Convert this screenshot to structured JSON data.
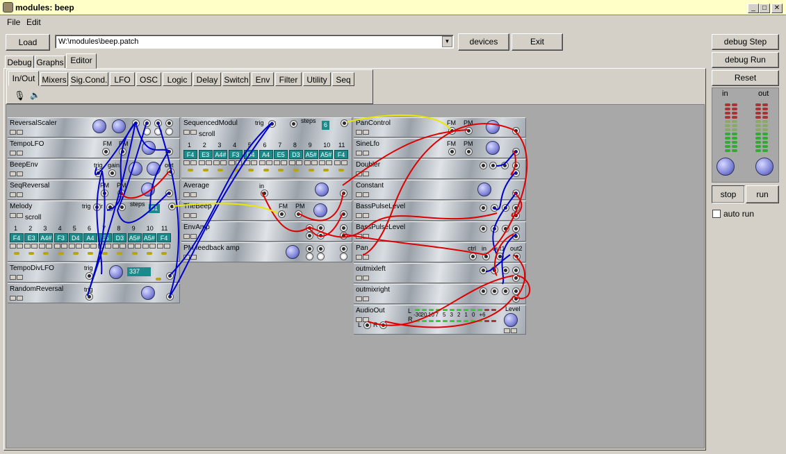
{
  "window": {
    "title": "modules: beep",
    "min": "_",
    "max": "□",
    "close": "✕"
  },
  "menu": {
    "file": "File",
    "edit": "Edit"
  },
  "toolbar": {
    "load": "Load",
    "path": "W:\\modules\\beep.patch",
    "devices": "devices",
    "exit": "Exit"
  },
  "side": {
    "debug_step": "debug Step",
    "debug_run": "debug Run",
    "reset": "Reset",
    "in": "in",
    "out": "out",
    "stop": "stop",
    "run": "run",
    "auto_run": "auto run"
  },
  "tabs": [
    "Debug",
    "Graphs",
    "Editor"
  ],
  "cat_tabs": [
    "In/Out",
    "Mixers",
    "Sig.Cond.",
    "LFO",
    "OSC",
    "Logic",
    "Delay",
    "Switch",
    "Env",
    "Filter",
    "Utility",
    "Seq"
  ],
  "modules": {
    "reversal_scaler": "ReversalScaler",
    "tempo_lfo": "TempoLFO",
    "beep_env": "BeepEnv",
    "seq_reversal": "SeqReversal",
    "melody": "Melody",
    "tempo_div_lfo": "TempoDivLFO",
    "random_reversal": "RandomReversal",
    "sequenced_modul": "SequencedModul",
    "average": "Average",
    "the_beep": "TheBeep",
    "env_amp": "EnvAmp",
    "pm_feedback": "PM feedback amp",
    "pan_control": "PanControl",
    "sine_lfo": "SineLfo",
    "doubler": "Doubler",
    "constant": "Constant",
    "bass_pulse_1": "BassPulseLevel",
    "bass_pulse_2": "BassPulseLevel",
    "pan": "Pan",
    "outmixleft": "outmixleft",
    "outmixright": "outmixright",
    "audio_out": "AudioOut"
  },
  "labels": {
    "fm": "FM",
    "pm": "PM",
    "trig": "trig",
    "gain": "gain",
    "out": "out",
    "dir": "dir",
    "steps": "steps",
    "scroll": "scroll",
    "in": "in",
    "ctrl": "ctrl",
    "out1": "out1",
    "out2": "out2",
    "level": "Level",
    "l": "L",
    "r": "R"
  },
  "values": {
    "melody_steps": "81",
    "seqmod_steps": "6",
    "tempodiv": "337"
  },
  "step_nums": [
    "1",
    "2",
    "3",
    "4",
    "5",
    "6",
    "7",
    "8",
    "9",
    "10",
    "11"
  ],
  "melody_notes": [
    "F4",
    "E3",
    "A4#",
    "F3",
    "D4",
    "A4",
    "E5",
    "D3",
    "A5#",
    "A5#",
    "F4"
  ],
  "seqmod_notes": [
    "F4",
    "E3",
    "A4#",
    "F3",
    "D4",
    "A4",
    "E5",
    "D3",
    "A5#",
    "A5#",
    "F4"
  ],
  "vu_scale": [
    "-30",
    "20",
    "10",
    "7",
    "5",
    "3",
    "2",
    "1",
    "0",
    "+6"
  ],
  "colors": {
    "wire_blue": "#0000cc",
    "wire_red": "#dd0000",
    "wire_yellow": "#e8e800",
    "seq_teal": "#1b8a8a",
    "knob": "#8a8fe0"
  }
}
